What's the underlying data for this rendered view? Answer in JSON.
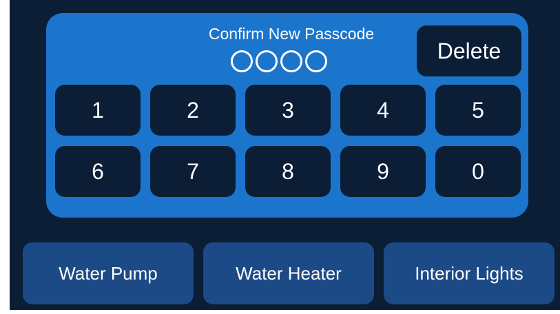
{
  "screen": {
    "title": "Confirm New Passcode",
    "passcode_length": 4,
    "digits_entered": 0,
    "delete_label": "Delete"
  },
  "keypad": {
    "row1": [
      "1",
      "2",
      "3",
      "4",
      "5"
    ],
    "row2": [
      "6",
      "7",
      "8",
      "9",
      "0"
    ]
  },
  "bottom_nav": {
    "water_pump": "Water Pump",
    "water_heater": "Water Heater",
    "interior_lights": "Interior Lights"
  },
  "colors": {
    "background": "#0b1e36",
    "panel": "#1b75cc",
    "key": "#0b1e36",
    "bottom_button": "#1c4a86",
    "text": "#ffffff"
  }
}
